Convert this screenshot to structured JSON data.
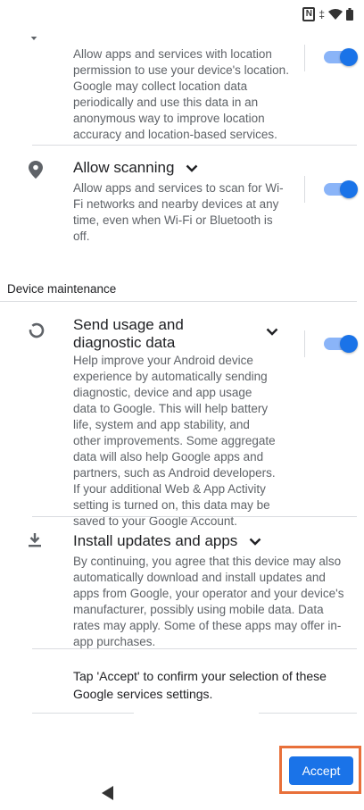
{
  "status_bar": {
    "nfc_icon": "N",
    "vibrate_icon": "‡"
  },
  "location_accuracy": {
    "description": "Allow apps and services with location permission to use your device's location. Google may collect location data periodically and use this data in an anonymous way to improve location accuracy and location-based services.",
    "toggle_on": true
  },
  "scanning": {
    "title": "Allow scanning",
    "description": "Allow apps and services to scan for Wi-Fi networks and nearby devices at any time, even when Wi-Fi or Bluetooth is off.",
    "toggle_on": true
  },
  "section_device_maintenance": "Device maintenance",
  "usage_diagnostics": {
    "title": "Send usage and diagnostic data",
    "description": "Help improve your Android device experience by automatically sending diagnostic, device and app usage data to Google. This will help battery life, system and app stability, and other improvements. Some aggregate data will also help Google apps and partners, such as Android developers. If your additional Web & App Activity setting is turned on, this data may be saved to your Google Account.",
    "toggle_on": true
  },
  "install_updates": {
    "title": "Install updates and apps",
    "description": "By continuing, you agree that this device may also automatically download and install updates and apps from Google, your operator and your device's manufacturer, possibly using mobile data. Data rates may apply. Some of these apps may offer in-app purchases."
  },
  "confirm_text": "Tap 'Accept' to confirm your selection of these Google services settings.",
  "accept_button": "Accept",
  "colors": {
    "accent": "#1a73e8",
    "highlight_border": "#e8703a"
  }
}
